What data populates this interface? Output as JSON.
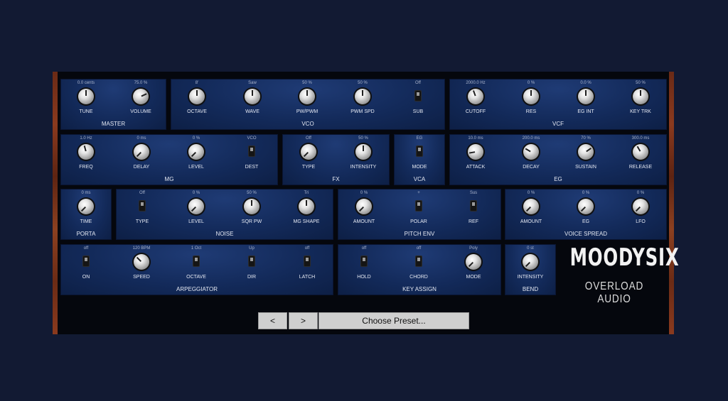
{
  "sections": {
    "master": {
      "title": "MASTER",
      "controls": [
        {
          "label": "TUNE",
          "value": "0.0 cents"
        },
        {
          "label": "VOLUME",
          "value": "75.0 %"
        }
      ]
    },
    "vco": {
      "title": "VCO",
      "controls": [
        {
          "label": "OCTAVE",
          "value": "8'"
        },
        {
          "label": "WAVE",
          "value": "Saw"
        },
        {
          "label": "PW/PWM",
          "value": "50 %"
        },
        {
          "label": "PWM SPD",
          "value": "50 %"
        },
        {
          "label": "SUB",
          "value": "Off"
        }
      ]
    },
    "vcf": {
      "title": "VCF",
      "controls": [
        {
          "label": "CUTOFF",
          "value": "2000.0 Hz"
        },
        {
          "label": "RES",
          "value": "0 %"
        },
        {
          "label": "EG INT",
          "value": "0.0 %"
        },
        {
          "label": "KEY TRK",
          "value": "50 %"
        }
      ]
    },
    "mg": {
      "title": "MG",
      "controls": [
        {
          "label": "FREQ",
          "value": "1.0 Hz"
        },
        {
          "label": "DELAY",
          "value": "0 ms"
        },
        {
          "label": "LEVEL",
          "value": "0 %"
        },
        {
          "label": "DEST",
          "value": "VCO"
        }
      ]
    },
    "fx": {
      "title": "FX",
      "controls": [
        {
          "label": "TYPE",
          "value": "Off"
        },
        {
          "label": "INTENSITY",
          "value": "50 %"
        }
      ]
    },
    "vca": {
      "title": "VCA",
      "controls": [
        {
          "label": "MODE",
          "value": "EG"
        }
      ]
    },
    "eg": {
      "title": "EG",
      "controls": [
        {
          "label": "ATTACK",
          "value": "10.0 ms"
        },
        {
          "label": "DECAY",
          "value": "200.0 ms"
        },
        {
          "label": "SUSTAIN",
          "value": "70 %"
        },
        {
          "label": "RELEASE",
          "value": "300.0 ms"
        }
      ]
    },
    "porta": {
      "title": "PORTA",
      "controls": [
        {
          "label": "TIME",
          "value": "0 ms"
        }
      ]
    },
    "noise": {
      "title": "NOISE",
      "controls": [
        {
          "label": "TYPE",
          "value": "Off"
        },
        {
          "label": "LEVEL",
          "value": "0 %"
        },
        {
          "label": "SQR PW",
          "value": "50 %"
        },
        {
          "label": "MG SHAPE",
          "value": "Tri"
        }
      ]
    },
    "pitch_env": {
      "title": "PITCH ENV",
      "controls": [
        {
          "label": "AMOUNT",
          "value": "0 %"
        },
        {
          "label": "POLAR",
          "value": "+"
        },
        {
          "label": "REF",
          "value": "Sus"
        }
      ]
    },
    "voice_spread": {
      "title": "VOICE SPREAD",
      "controls": [
        {
          "label": "AMOUNT",
          "value": "0 %"
        },
        {
          "label": "EG",
          "value": "0 %"
        },
        {
          "label": "LFO",
          "value": "0 %"
        }
      ]
    },
    "arpeggiator": {
      "title": "ARPEGGIATOR",
      "controls": [
        {
          "label": "ON",
          "value": "off"
        },
        {
          "label": "SPEED",
          "value": "120 BPM"
        },
        {
          "label": "OCTAVE",
          "value": "1 Oct"
        },
        {
          "label": "DIR",
          "value": "Up"
        },
        {
          "label": "LATCH",
          "value": "off"
        }
      ]
    },
    "key_assign": {
      "title": "KEY ASSIGN",
      "controls": [
        {
          "label": "HOLD",
          "value": "off"
        },
        {
          "label": "CHORD",
          "value": "off"
        },
        {
          "label": "MODE",
          "value": "Poly"
        }
      ]
    },
    "bend": {
      "title": "BEND",
      "controls": [
        {
          "label": "INTENSITY",
          "value": "0 st"
        }
      ]
    }
  },
  "logo": {
    "title": "MOODYSIX",
    "subtitle": "OVERLOAD AUDIO"
  },
  "preset_bar": {
    "prev_label": "<",
    "next_label": ">",
    "choose_label": "Choose Preset..."
  }
}
